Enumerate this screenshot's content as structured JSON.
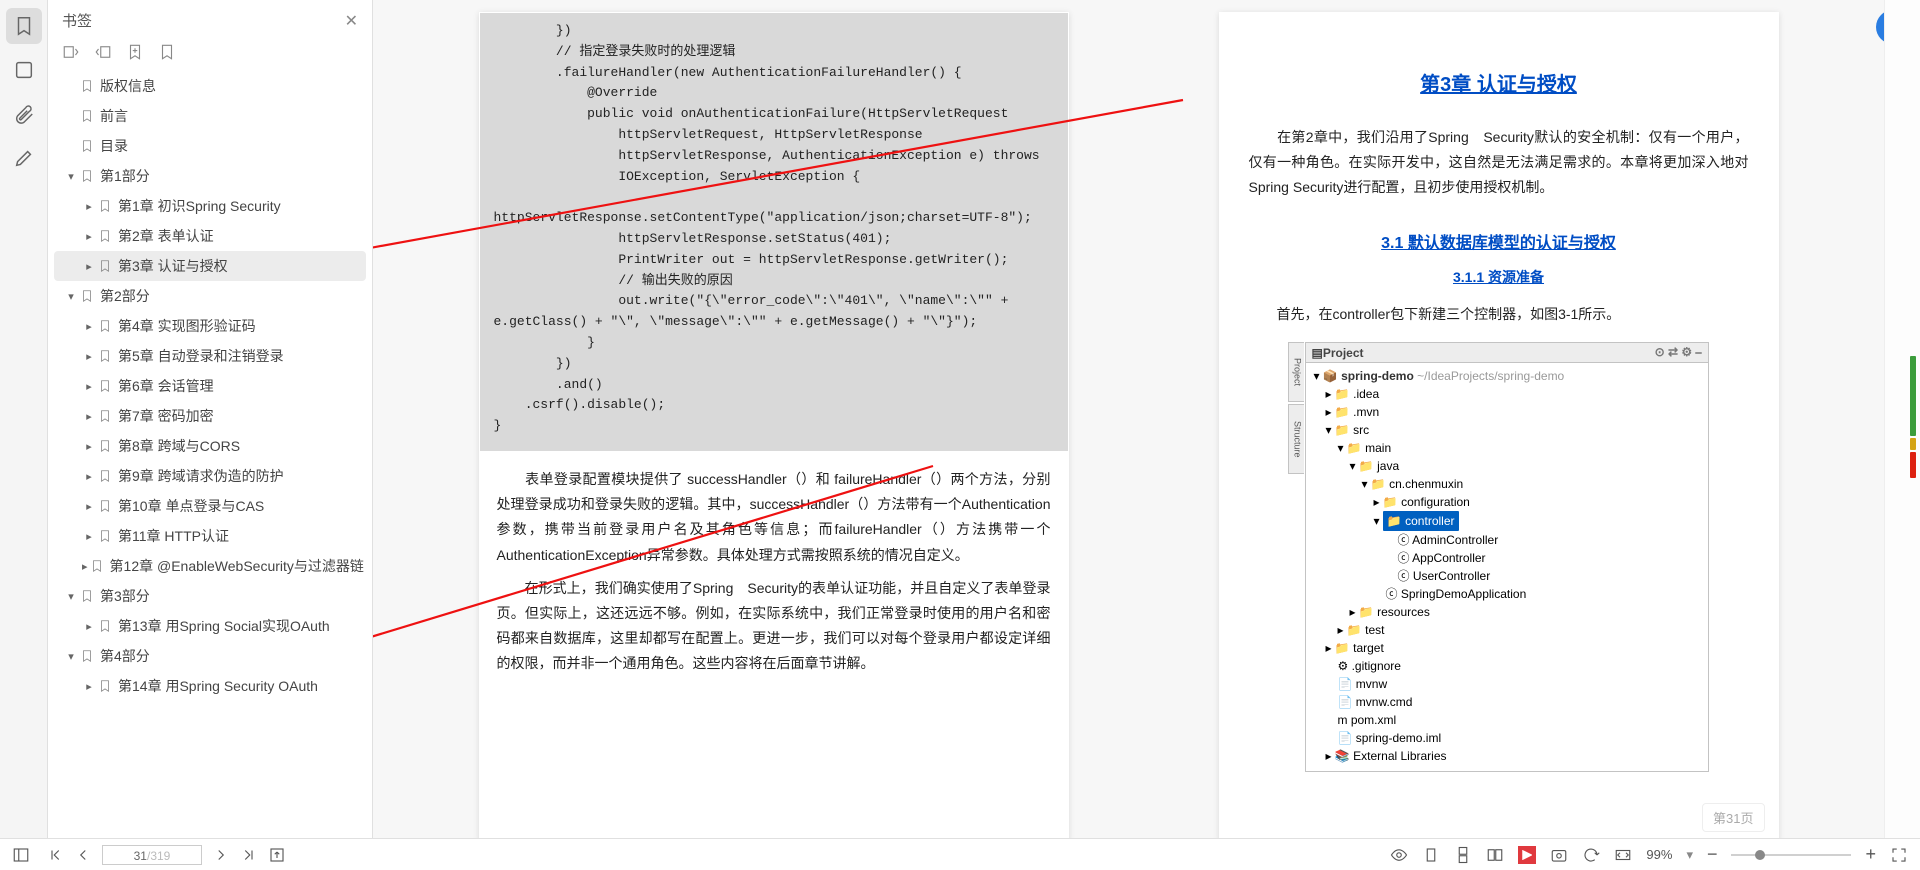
{
  "panel": {
    "title": "书签"
  },
  "bookmarks": [
    {
      "level": 0,
      "caret": "",
      "label": "版权信息"
    },
    {
      "level": 0,
      "caret": "",
      "label": "前言"
    },
    {
      "level": 0,
      "caret": "",
      "label": "目录"
    },
    {
      "level": 0,
      "caret": "▾",
      "label": "第1部分"
    },
    {
      "level": 1,
      "caret": "▸",
      "label": "第1章 初识Spring Security"
    },
    {
      "level": 1,
      "caret": "▸",
      "label": "第2章 表单认证"
    },
    {
      "level": 1,
      "caret": "▸",
      "label": "第3章 认证与授权",
      "selected": true
    },
    {
      "level": 0,
      "caret": "▾",
      "label": "第2部分"
    },
    {
      "level": 1,
      "caret": "▸",
      "label": "第4章 实现图形验证码"
    },
    {
      "level": 1,
      "caret": "▸",
      "label": "第5章 自动登录和注销登录"
    },
    {
      "level": 1,
      "caret": "▸",
      "label": "第6章 会话管理"
    },
    {
      "level": 1,
      "caret": "▸",
      "label": "第7章 密码加密"
    },
    {
      "level": 1,
      "caret": "▸",
      "label": "第8章 跨域与CORS"
    },
    {
      "level": 1,
      "caret": "▸",
      "label": "第9章 跨域请求伪造的防护"
    },
    {
      "level": 1,
      "caret": "▸",
      "label": "第10章 单点登录与CAS"
    },
    {
      "level": 1,
      "caret": "▸",
      "label": "第11章 HTTP认证"
    },
    {
      "level": 1,
      "caret": "▸",
      "label": "第12章 @EnableWebSecurity与过滤器链"
    },
    {
      "level": 0,
      "caret": "▾",
      "label": "第3部分"
    },
    {
      "level": 1,
      "caret": "▸",
      "label": "第13章 用Spring Social实现OAuth"
    },
    {
      "level": 0,
      "caret": "▾",
      "label": "第4部分"
    },
    {
      "level": 1,
      "caret": "▸",
      "label": "第14章 用Spring Security OAuth"
    }
  ],
  "code": "        })\n        // 指定登录失败时的处理逻辑\n        .failureHandler(new AuthenticationFailureHandler() {\n            @Override\n            public void onAuthenticationFailure(HttpServletRequest\n                httpServletRequest, HttpServletResponse\n                httpServletResponse, AuthenticationException e) throws\n                IOException, ServletException {\n\nhttpServletResponse.setContentType(\"application/json;charset=UTF-8\");\n                httpServletResponse.setStatus(401);\n                PrintWriter out = httpServletResponse.getWriter();\n                // 输出失败的原因\n                out.write(\"{\\\"error_code\\\":\\\"401\\\", \\\"name\\\":\\\"\" + \ne.getClass() + \"\\\", \\\"message\\\":\\\"\" + e.getMessage() + \"\\\"}\");\n            }\n        })\n        .and()\n    .csrf().disable();\n}",
  "para1": "　　表单登录配置模块提供了 successHandler（）和 failureHandler（）两个方法，分别处理登录成功和登录失败的逻辑。其中，successHandler（）方法带有一个Authentication参数，携带当前登录用户名及其角色等信息；而failureHandler（）方法携带一个AuthenticationException异常参数。具体处理方式需按照系统的情况自定义。",
  "para2": "　　在形式上，我们确实使用了Spring　Security的表单认证功能，并且自定义了表单登录页。但实际上，这还远远不够。例如，在实际系统中，我们正常登录时使用的用户名和密码都来自数据库，这里却都写在配置上。更进一步，我们可以对每个登录用户都设定详细的权限，而并非一个通用角色。这些内容将在后面章节讲解。",
  "chapter": {
    "title": "第3章 认证与授权",
    "text1": "　　在第2章中，我们沿用了Spring　Security默认的安全机制：仅有一个用户，仅有一种角色。在实际开发中，这自然是无法满足需求的。本章将更加深入地对Spring Security进行配置，且初步使用授权机制。",
    "section": "3.1 默认数据库模型的认证与授权",
    "subsection": "3.1.1 资源准备",
    "text2": "　　首先，在controller包下新建三个控制器，如图3-1所示。"
  },
  "projectTree": {
    "title": "Project",
    "root": "spring-demo  ~/IdeaProjects/spring-demo",
    "items": [
      "▸ 📁 .idea",
      "▸ 📁 .mvn",
      "▾ 📁 src",
      "  ▾ 📁 main",
      "    ▾ 📁 java",
      "      ▾ 📁 cn.chenmuxin",
      "        ▸ 📁 configuration",
      "        ▾ 📁 controller",
      "            ⓒ AdminController",
      "            ⓒ AppController",
      "            ⓒ UserController",
      "          ⓒ SpringDemoApplication",
      "    ▸ 📁 resources",
      "  ▸ 📁 test",
      "▸ 📁 target",
      "  ⚙ .gitignore",
      "  📄 mvnw",
      "  📄 mvnw.cmd",
      "  m pom.xml",
      "  📄 spring-demo.iml",
      "▸ 📚 External Libraries"
    ],
    "selected_idx": 7,
    "selected_label": "controller",
    "side_tabs": [
      "Project",
      "Structure"
    ]
  },
  "pager": {
    "current": 31,
    "total": 319
  },
  "zoom": "99%",
  "page_indicator": "第31页"
}
